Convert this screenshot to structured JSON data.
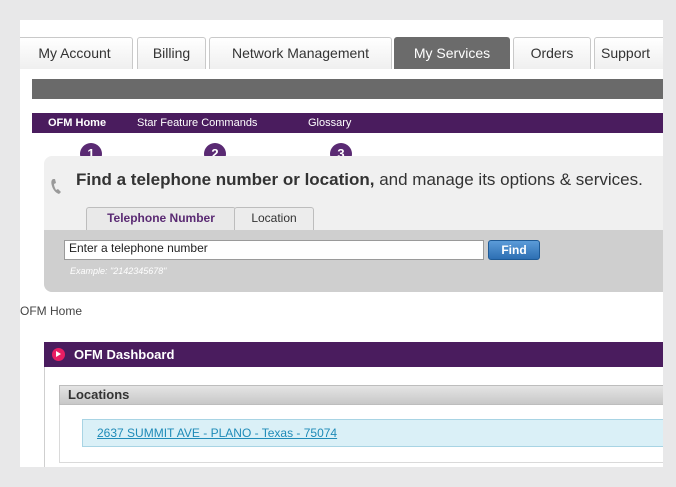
{
  "top_tabs": [
    {
      "label": "My Account",
      "active": false
    },
    {
      "label": "Billing",
      "active": false
    },
    {
      "label": "Network Management",
      "active": false
    },
    {
      "label": "My Services",
      "active": true
    },
    {
      "label": "Orders",
      "active": false
    },
    {
      "label": "Support",
      "active": false
    }
  ],
  "sub_nav": [
    {
      "label": "OFM Home",
      "active": true
    },
    {
      "label": "Star Feature Commands",
      "active": false
    },
    {
      "label": "Glossary",
      "active": false
    }
  ],
  "badges": [
    "1",
    "2",
    "3"
  ],
  "find": {
    "heading_bold": "Find a telephone number or location,",
    "heading_rest": " and manage its options & services.",
    "tabs": [
      "Telephone Number",
      "Location"
    ],
    "input_value": "Enter a telephone number",
    "button_label": "Find",
    "example": "Example: \"2142345678\""
  },
  "breadcrumb": "OFM Home",
  "dashboard": {
    "title": "OFM Dashboard",
    "locations_title": "Locations",
    "locations": [
      "2637 SUMMIT AVE - PLANO - Texas - 75074"
    ]
  },
  "colors": {
    "nav_purple": "#4a1c5e",
    "badge_purple": "#5a2a73",
    "active_tab": "#6b6b6b",
    "link_blue": "#1f8bb8",
    "find_button": "#2d6fb3",
    "collapse_icon": "#e91e63"
  },
  "icons": {
    "phone": "phone-icon",
    "collapse": "collapse-icon"
  }
}
